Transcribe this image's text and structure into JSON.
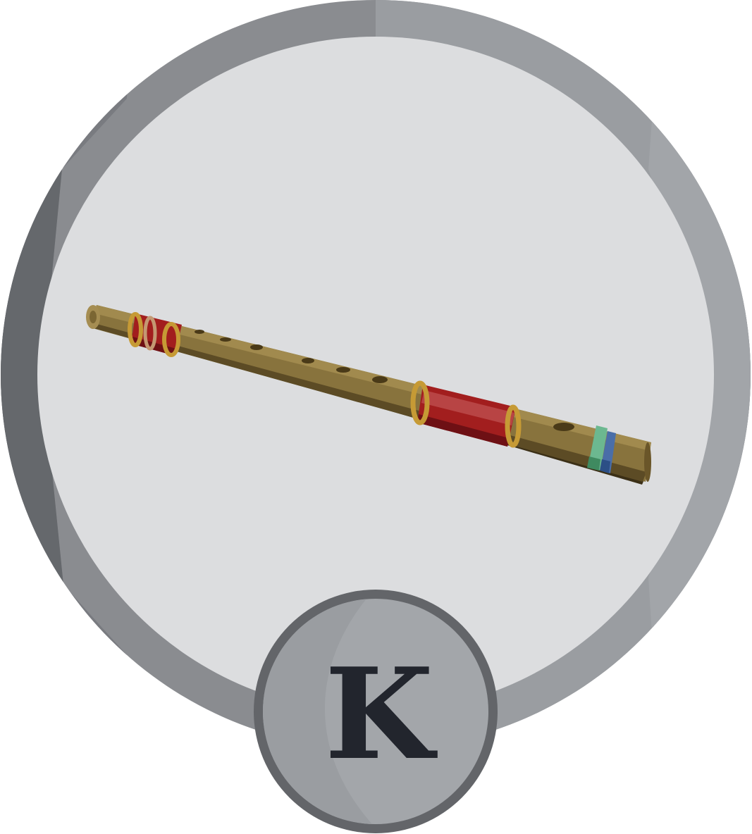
{
  "badge": {
    "letter": "K",
    "instrument_icon": "flute-icon"
  },
  "colors": {
    "ring_outer": "#8a8c90",
    "ring_dark": "#65686c",
    "ring_light": "#9ea1a5",
    "disc_inner": "#dcdddf",
    "letter_badge_fill": "#a3a6aa",
    "letter_badge_shade": "#9a9da1",
    "letter_badge_rim": "#636569",
    "letter_color": "#22252d",
    "flute_body": "#88733d",
    "flute_top_highlight": "#a18a4e",
    "flute_shadow": "#5c4b25",
    "flute_edge": "#3b2f16",
    "wrap_red": "#a21e1e",
    "wrap_dark_red": "#6e1014",
    "band_gold": "#c69a35",
    "band_green": "#6cb890",
    "band_blue": "#4a6ea8"
  }
}
